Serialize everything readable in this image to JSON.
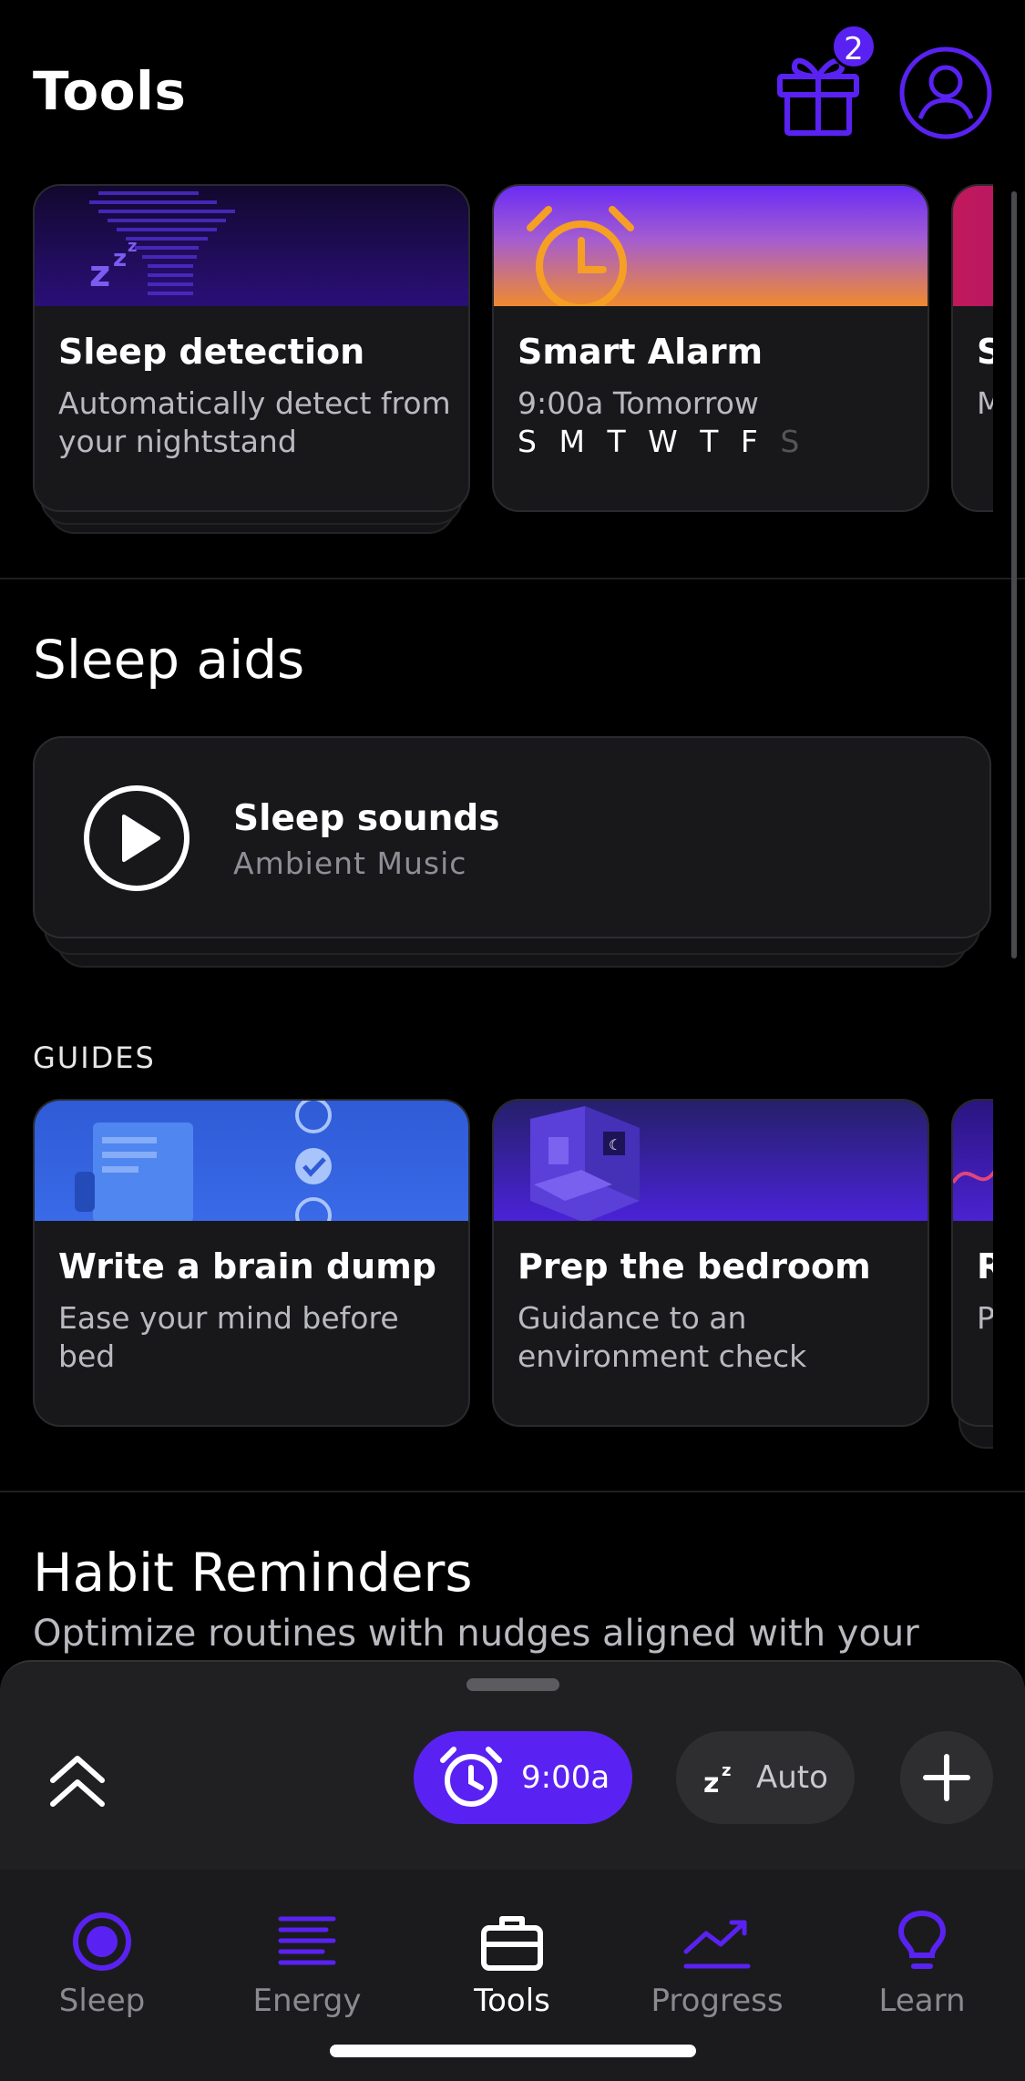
{
  "header": {
    "title": "Tools",
    "gift_count": "2"
  },
  "colors": {
    "accent": "#5a22f2",
    "background": "#000000",
    "card": "#18181b"
  },
  "tools_cards": [
    {
      "title": "Sleep detection",
      "subtitle": "Automatically detect from your nightstand"
    },
    {
      "title": "Smart Alarm",
      "subtitle": "9:00a Tomorrow",
      "days": [
        "S",
        "M",
        "T",
        "W",
        "T",
        "F",
        "S"
      ],
      "days_active": [
        true,
        true,
        true,
        true,
        true,
        true,
        false
      ]
    },
    {
      "title": "S",
      "subtitle": "M t"
    }
  ],
  "sleep_aids": {
    "title": "Sleep aids",
    "sounds": {
      "title": "Sleep sounds",
      "subtitle": "Ambient Music"
    }
  },
  "guides": {
    "label": "GUIDES",
    "cards": [
      {
        "title": "Write a brain dump",
        "subtitle": "Ease your mind before bed"
      },
      {
        "title": "Prep the bedroom",
        "subtitle": "Guidance to an environment check"
      },
      {
        "title": "R",
        "subtitle": "P r"
      }
    ]
  },
  "habits": {
    "title": "Habit Reminders",
    "subtitle": "Optimize routines with nudges aligned with your"
  },
  "bottom_sheet": {
    "alarm_label": "9:00a",
    "auto_label": "Auto"
  },
  "tabs": [
    {
      "label": "Sleep",
      "icon": "sleep-icon"
    },
    {
      "label": "Energy",
      "icon": "energy-icon"
    },
    {
      "label": "Tools",
      "icon": "toolbox-icon",
      "active": true
    },
    {
      "label": "Progress",
      "icon": "progress-icon"
    },
    {
      "label": "Learn",
      "icon": "lightbulb-icon"
    }
  ]
}
